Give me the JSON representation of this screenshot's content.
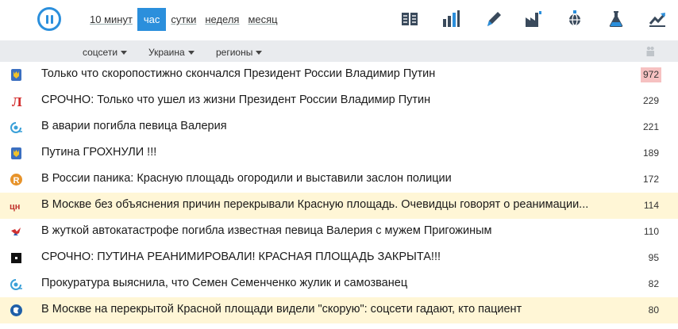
{
  "header": {
    "logo_icon": "pause-circle-icon",
    "periods": [
      "10 минут",
      "час",
      "сутки",
      "неделя",
      "месяц"
    ],
    "active_period": "час",
    "tools": [
      "newspaper-icon",
      "bar-chart-icon",
      "pen-icon",
      "factory-icon",
      "globe-icon",
      "flask-icon",
      "trend-up-icon"
    ]
  },
  "filters": {
    "items": [
      "соцсети",
      "Украина",
      "регионы"
    ],
    "users_icon": "users-icon"
  },
  "news": [
    {
      "source_icon": "trident-icon",
      "title": "Только что скоропостижно скончался Президент России Владимир Путин",
      "count": "972",
      "hot": true,
      "highlight": false
    },
    {
      "source_icon": "red-l-icon",
      "title": "СРОЧНО: Только что ушел из жизни Президент России Владимир Путин",
      "count": "229",
      "hot": false,
      "highlight": false
    },
    {
      "source_icon": "blue-swirl-icon",
      "title": "В аварии погибла певица Валерия",
      "count": "221",
      "hot": false,
      "highlight": false
    },
    {
      "source_icon": "trident-icon",
      "title": "Путина ГРОХНУЛИ !!!",
      "count": "189",
      "hot": false,
      "highlight": false
    },
    {
      "source_icon": "orange-r-icon",
      "title": "В России паника: Красную площадь огородили и выставили заслон полиции",
      "count": "172",
      "hot": false,
      "highlight": false
    },
    {
      "source_icon": "ch-logo-icon",
      "title": "В Москве без объяснения причин перекрывали Красную площадь. Очевидцы говорят о реанимации...",
      "count": "114",
      "hot": false,
      "highlight": true
    },
    {
      "source_icon": "bird-icon",
      "title": "В жуткой автокатастрофе погибла известная певица Валерия с мужем Пригожиным",
      "count": "110",
      "hot": false,
      "highlight": false
    },
    {
      "source_icon": "black-square-icon",
      "title": "СРОЧНО: ПУТИНА РЕАНИМИРОВАЛИ! КРАСНАЯ ПЛОЩАДЬ ЗАКРЫТА!!!",
      "count": "95",
      "hot": false,
      "highlight": false
    },
    {
      "source_icon": "blue-swirl-icon",
      "title": "Прокуратура выяснила, что Семен Семенченко жулик и самозванец",
      "count": "82",
      "hot": false,
      "highlight": false
    },
    {
      "source_icon": "blue-globe-icon",
      "title": "В Москве на перекрытой Красной площади видели \"скорую\": соцсети гадают, кто пациент",
      "count": "80",
      "hot": false,
      "highlight": true
    }
  ],
  "colors": {
    "accent": "#2b8fdc",
    "hot": "#f6c1c1",
    "highlight": "#fff6d6",
    "filterbar": "#e9ebee",
    "icons": "#3a4a5c"
  }
}
